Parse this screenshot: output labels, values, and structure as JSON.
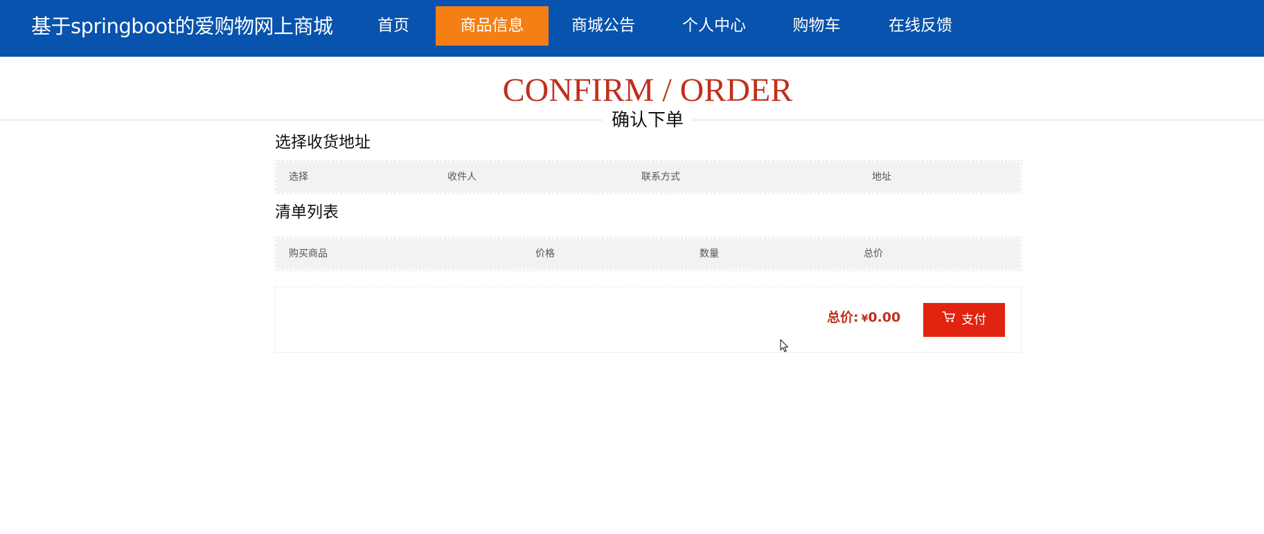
{
  "header": {
    "site_title": "基于springboot的爱购物网上商城",
    "nav": [
      {
        "label": "首页",
        "active": false
      },
      {
        "label": "商品信息",
        "active": true
      },
      {
        "label": "商城公告",
        "active": false
      },
      {
        "label": "个人中心",
        "active": false
      },
      {
        "label": "购物车",
        "active": false
      },
      {
        "label": "在线反馈",
        "active": false
      }
    ]
  },
  "page": {
    "heading_en": "CONFIRM / ORDER",
    "heading_cn": "确认下单"
  },
  "address_section": {
    "title": "选择收货地址",
    "columns": [
      "选择",
      "收件人",
      "联系方式",
      "地址"
    ]
  },
  "list_section": {
    "title": "清单列表",
    "columns": [
      "购买商品",
      "价格",
      "数量",
      "总价"
    ]
  },
  "summary": {
    "total_label": "总价:",
    "currency": "¥",
    "total_value": "0.00",
    "pay_label": "支付"
  },
  "icons": {
    "pay_icon": "cart-icon",
    "cursor": "mouse-pointer-icon"
  },
  "colors": {
    "topbar": "#0753ad",
    "active_nav": "#f57f14",
    "accent_red": "#c0301b",
    "pay_button": "#e1230f"
  }
}
